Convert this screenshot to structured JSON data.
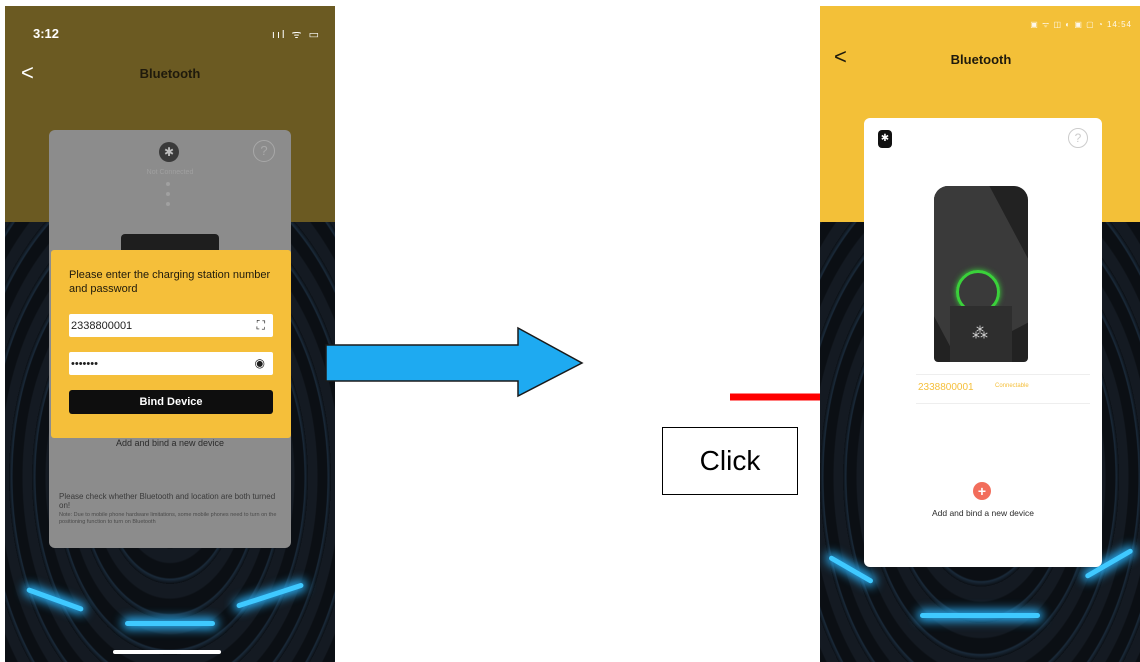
{
  "left_screen": {
    "status_time": "3:12",
    "status_icons": "ııl ᯤ ▭",
    "back_label": "<",
    "title": "Bluetooth",
    "help_label": "?",
    "bluetooth_glyph": "✱",
    "connection_status": "Not Connected",
    "dialog": {
      "prompt": "Please enter the charging station number and password",
      "station_number": "2338800001",
      "scan_icon_glyph": "⛶",
      "password_masked": "•••••••",
      "eye_icon_glyph": "◉",
      "bind_button": "Bind Device"
    },
    "add_link": "Add and bind a new device",
    "note": "Please check whether Bluetooth and location are both turned on!",
    "note_small": "Note: Due to mobile phone hardware limitations, some mobile phones need to turn on the positioning function to turn on Bluetooth"
  },
  "annotation": {
    "click_label": "Click",
    "arrow_blue_color": "#1eaaf1",
    "arrow_red_color": "#ff0000"
  },
  "right_screen": {
    "status_icons": "▣ ᯤ ◫ ◐ ▣ ▢ ◔ 14:54",
    "back_label": "<",
    "title": "Bluetooth",
    "help_label": "?",
    "bluetooth_glyph": "✱",
    "device_number": "2338800001",
    "device_state": "Connectable",
    "add_plus_glyph": "+",
    "add_text": "Add and bind a new device",
    "spinner_glyph": "⁂"
  }
}
